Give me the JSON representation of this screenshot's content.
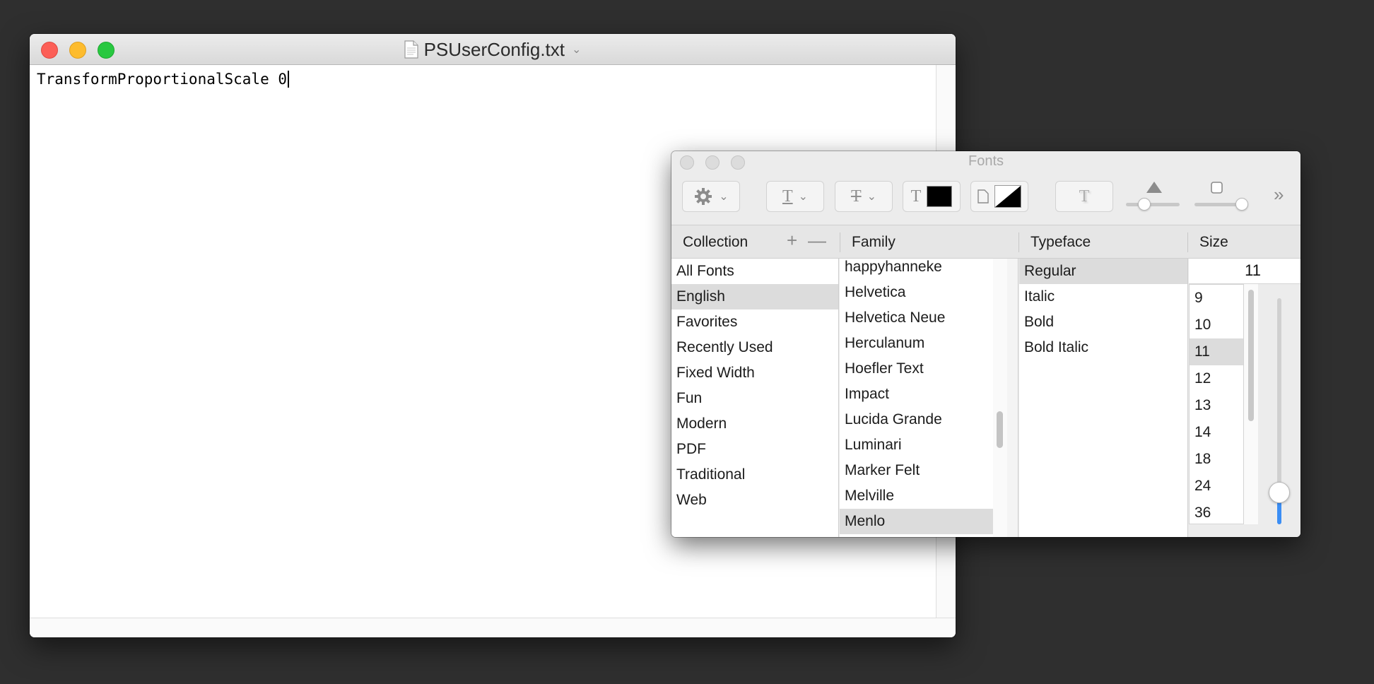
{
  "textedit": {
    "title": "PSUserConfig.txt",
    "content": "TransformProportionalScale 0"
  },
  "fonts_panel": {
    "title": "Fonts",
    "toolbar": {
      "gear": "gear-icon",
      "underline": "T",
      "strikethrough": "T",
      "text_color_label": "T",
      "text_color": "#000000",
      "doc_color": "#000000",
      "shadow": "T",
      "more": "»"
    },
    "headers": {
      "collection": "Collection",
      "family": "Family",
      "typeface": "Typeface",
      "size": "Size"
    },
    "collections": [
      "All Fonts",
      "English",
      "Favorites",
      "Recently Used",
      "Fixed Width",
      "Fun",
      "Modern",
      "PDF",
      "Traditional",
      "Web"
    ],
    "selected_collection": "English",
    "families": [
      "happyhanneke",
      "Helvetica",
      "Helvetica Neue",
      "Herculanum",
      "Hoefler Text",
      "Impact",
      "Lucida Grande",
      "Luminari",
      "Marker Felt",
      "Melville",
      "Menlo"
    ],
    "selected_family": "Menlo",
    "typefaces": [
      "Regular",
      "Italic",
      "Bold",
      "Bold Italic"
    ],
    "selected_typeface": "Regular",
    "size_value": "11",
    "sizes": [
      "9",
      "10",
      "11",
      "12",
      "13",
      "14",
      "18",
      "24",
      "36"
    ],
    "selected_size": "11"
  }
}
